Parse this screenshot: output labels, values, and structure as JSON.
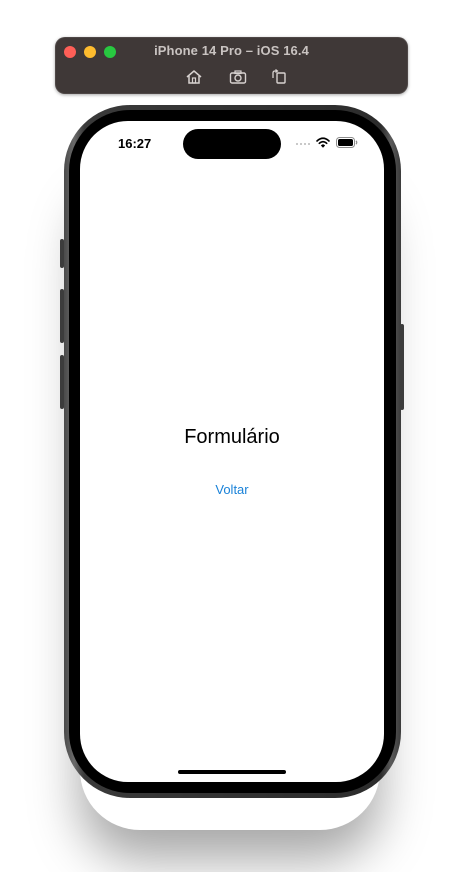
{
  "simulator": {
    "title": "iPhone 14 Pro – iOS 16.4",
    "toolbar_icons": [
      "home-icon",
      "screenshot-icon",
      "rotate-icon"
    ]
  },
  "status_bar": {
    "time": "16:27",
    "icons": [
      "cellular-dots-icon",
      "wifi-icon",
      "battery-icon"
    ]
  },
  "screen": {
    "title": "Formulário",
    "back_link": "Voltar"
  },
  "colors": {
    "link": "#1a82d8",
    "toolbar_bg": "#3f3837",
    "close": "#fe5f57",
    "minimize": "#febc2e",
    "maximize": "#28c840"
  }
}
